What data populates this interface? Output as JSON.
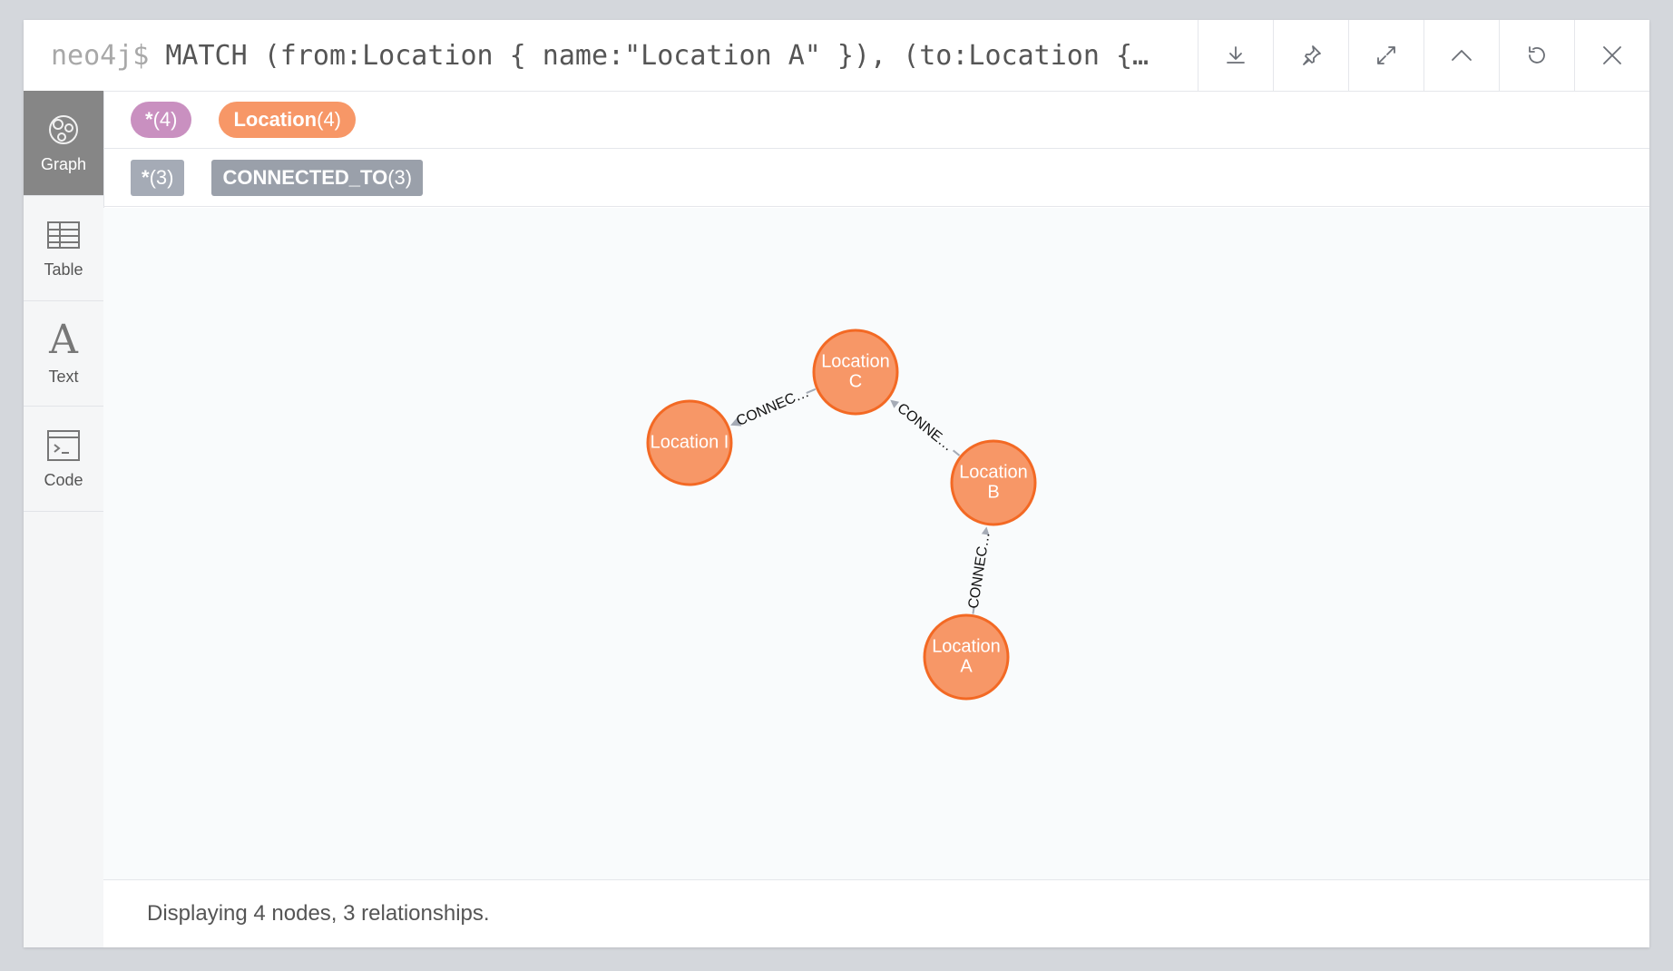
{
  "header": {
    "prompt": "neo4j$",
    "query": "MATCH (from:Location { name:\"Location A\" }), (to:Location {…"
  },
  "sidebar": {
    "items": [
      {
        "label": "Graph",
        "icon": "graph-icon",
        "active": true
      },
      {
        "label": "Table",
        "icon": "table-icon",
        "active": false
      },
      {
        "label": "Text",
        "icon": "text-icon",
        "active": false
      },
      {
        "label": "Code",
        "icon": "code-icon",
        "active": false
      }
    ]
  },
  "legend": {
    "nodes": [
      {
        "label": "*",
        "count": "(4)",
        "color": "#c990c0"
      },
      {
        "label": "Location",
        "count": "(4)",
        "color": "#f79767"
      }
    ],
    "relationships": [
      {
        "label": "*",
        "count": "(3)",
        "color": "#a5abb6"
      },
      {
        "label": "CONNECTED_TO",
        "count": "(3)",
        "color": "#a5abb6"
      }
    ]
  },
  "graph": {
    "node_color": "#f79767",
    "node_border": "#f36924",
    "nodes": [
      {
        "id": "I",
        "lines": [
          "Location I"
        ]
      },
      {
        "id": "C",
        "lines": [
          "Location",
          "C"
        ]
      },
      {
        "id": "B",
        "lines": [
          "Location",
          "B"
        ]
      },
      {
        "id": "A",
        "lines": [
          "Location",
          "A"
        ]
      }
    ],
    "relationships": [
      {
        "from": "C",
        "to": "I",
        "label": "CONNEC…"
      },
      {
        "from": "B",
        "to": "C",
        "label": "CONNE…"
      },
      {
        "from": "A",
        "to": "B",
        "label": "CONNEC…"
      }
    ]
  },
  "footer": {
    "status": "Displaying 4 nodes, 3 relationships."
  }
}
